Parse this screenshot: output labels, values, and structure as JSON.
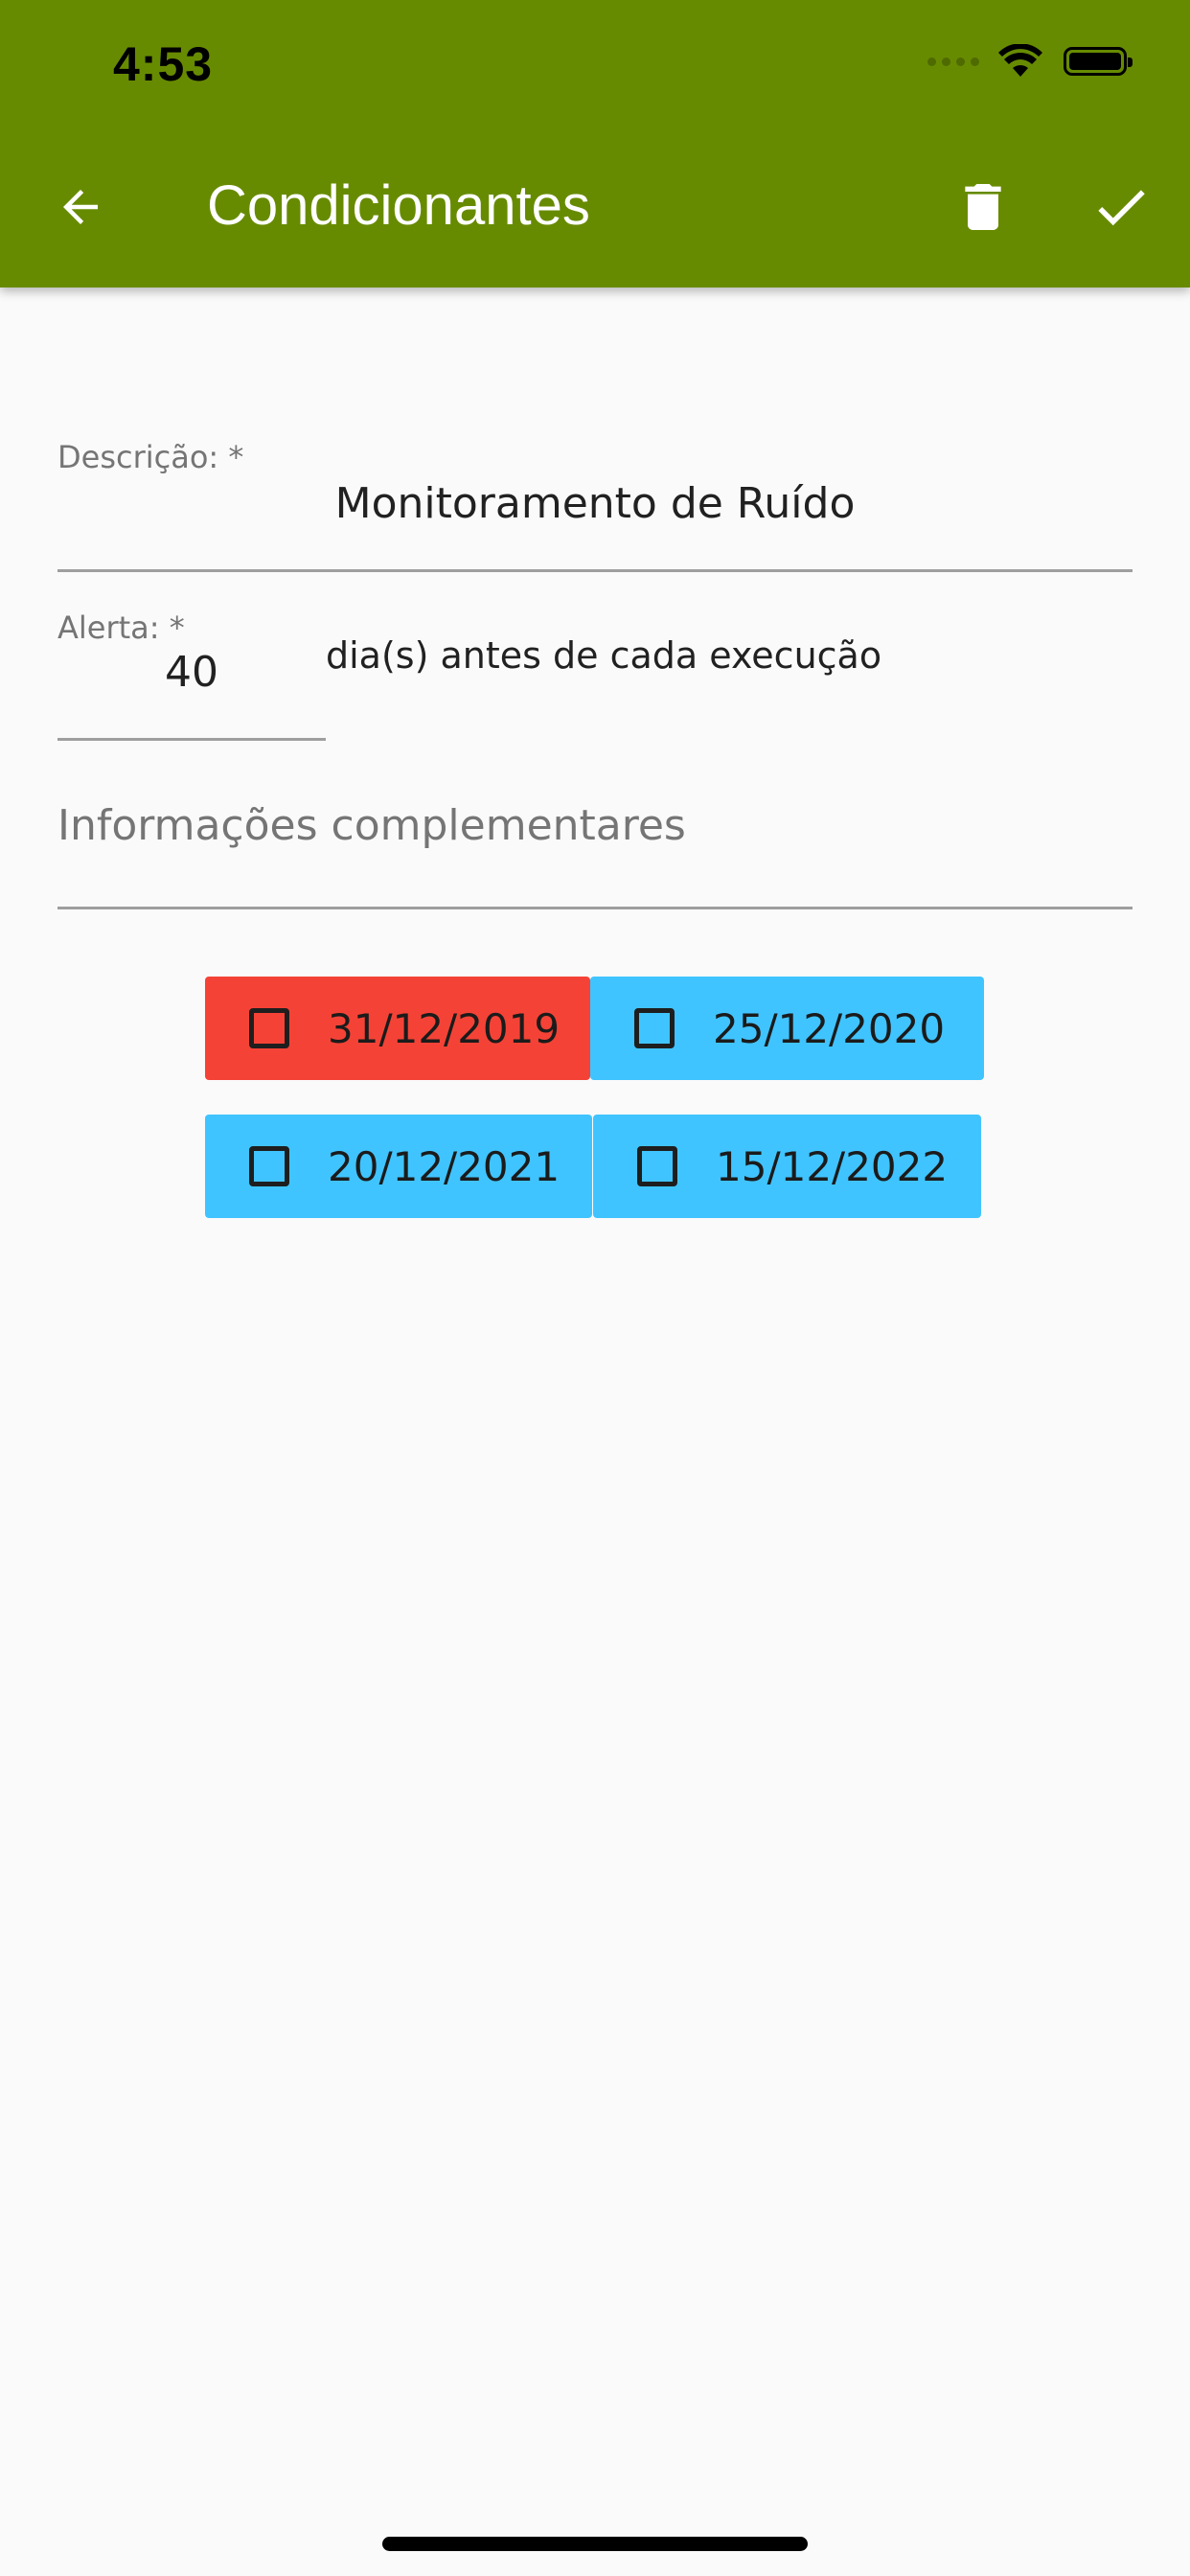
{
  "status_bar": {
    "time": "4:53",
    "icons": [
      "cellular-dots-icon",
      "wifi-icon",
      "battery-icon"
    ]
  },
  "app_bar": {
    "title": "Condicionantes",
    "back_icon": "arrow-back-icon",
    "delete_icon": "trash-icon",
    "confirm_icon": "check-icon",
    "background_color": "#678b00"
  },
  "form": {
    "descricao": {
      "label": "Descrição: *",
      "value": "Monitoramento de Ruído"
    },
    "alerta": {
      "label": "Alerta: *",
      "value": "40",
      "suffix": "dia(s) antes de cada execução"
    },
    "informacoes": {
      "placeholder": "Informações complementares",
      "value": ""
    }
  },
  "dates": [
    {
      "label": "31/12/2019",
      "checked": false,
      "color": "#f44336"
    },
    {
      "label": "25/12/2020",
      "checked": false,
      "color": "#40c4ff"
    },
    {
      "label": "20/12/2021",
      "checked": false,
      "color": "#40c4ff"
    },
    {
      "label": "15/12/2022",
      "checked": false,
      "color": "#40c4ff"
    }
  ]
}
